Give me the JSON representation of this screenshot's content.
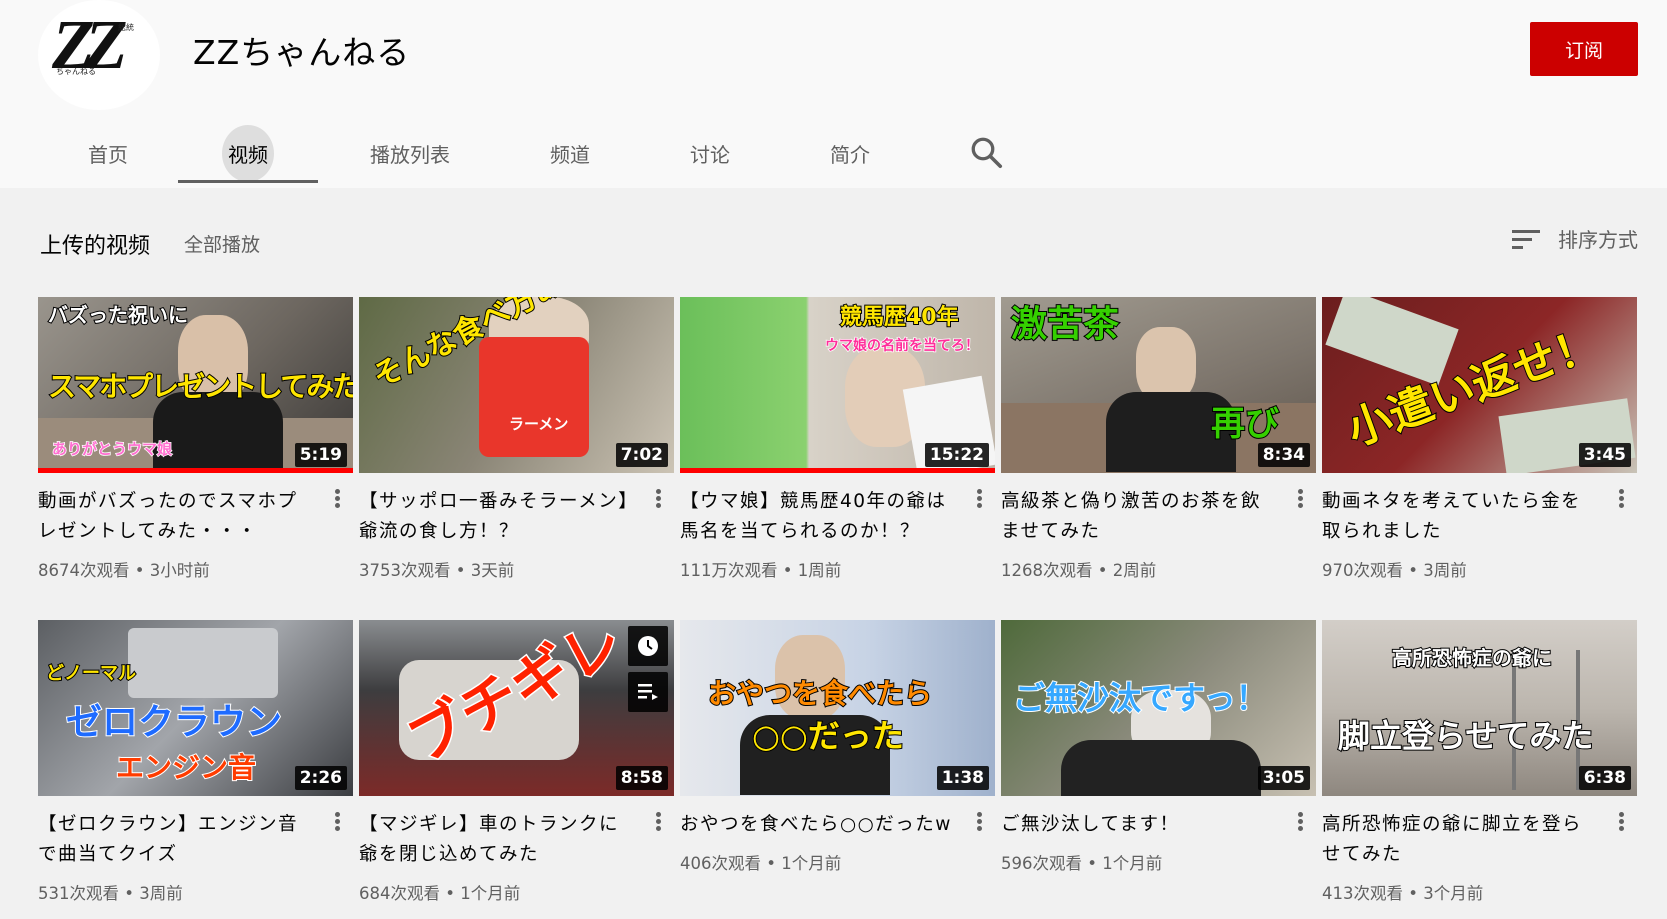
{
  "channel": {
    "name": "ZZちゃんねる",
    "avatar_text": "ZZ",
    "avatar_small_top": "総統",
    "avatar_small_bottom": "ちゃんねる",
    "subscribe_label": "订阅"
  },
  "tabs": [
    {
      "label": "首页",
      "active": false
    },
    {
      "label": "视频",
      "active": true
    },
    {
      "label": "播放列表",
      "active": false
    },
    {
      "label": "频道",
      "active": false
    },
    {
      "label": "讨论",
      "active": false
    },
    {
      "label": "简介",
      "active": false
    }
  ],
  "section": {
    "title": "上传的视频",
    "play_all": "全部播放",
    "sort_label": "排序方式"
  },
  "colors": {
    "subscribe": "#cc0000",
    "progress": "#ff0000",
    "text_secondary": "#606060"
  },
  "videos": [
    {
      "title": "動画がバズったのでスマホプレゼントしてみた・・・",
      "views": "8674次观看",
      "age": "3小时前",
      "duration": "5:19",
      "thumb_lines": [
        "バズった祝いに",
        "スマホプレゼントしてみた",
        "ありがとうウマ娘"
      ],
      "watched": 1.0
    },
    {
      "title": "【サッポロ一番みそラーメン】爺流の食し方！？",
      "views": "3753次观看",
      "age": "3天前",
      "duration": "7:02",
      "thumb_lines": [
        "そんな食べ方あり？",
        "ラーメン"
      ],
      "watched": 0
    },
    {
      "title": "【ウマ娘】競馬歴40年の爺は馬名を当てられるのか！？",
      "views": "111万次观看",
      "age": "1周前",
      "duration": "15:22",
      "thumb_lines": [
        "競馬歴40年",
        "ウマ娘の名前を当てろ！"
      ],
      "watched": 1.0
    },
    {
      "title": "高級茶と偽り激苦のお茶を飲ませてみた",
      "views": "1268次观看",
      "age": "2周前",
      "duration": "8:34",
      "thumb_lines": [
        "激苦茶",
        "再び"
      ],
      "watched": 0
    },
    {
      "title": "動画ネタを考えていたら金を取られました",
      "views": "970次观看",
      "age": "3周前",
      "duration": "3:45",
      "thumb_lines": [
        "小遣い返せ！"
      ],
      "watched": 0
    },
    {
      "title": "【ゼロクラウン】エンジン音で曲当てクイズ",
      "views": "531次观看",
      "age": "3周前",
      "duration": "2:26",
      "thumb_lines": [
        "どノーマル",
        "ゼロクラウン",
        "エンジン音"
      ],
      "watched": 0
    },
    {
      "title": "【マジギレ】車のトランクに爺を閉じ込めてみた",
      "views": "684次观看",
      "age": "1个月前",
      "duration": "8:58",
      "thumb_lines": [
        "ブチギレ"
      ],
      "watched": 0
    },
    {
      "title": "おやつを食べたら○○だったw",
      "views": "406次观看",
      "age": "1个月前",
      "duration": "1:38",
      "thumb_lines": [
        "おやつを食べたら",
        "○○だった"
      ],
      "watched": 0
    },
    {
      "title": "ご無沙汰してます！",
      "views": "596次观看",
      "age": "1个月前",
      "duration": "3:05",
      "thumb_lines": [
        "ご無沙汰ですっ！"
      ],
      "watched": 0
    },
    {
      "title": "高所恐怖症の爺に脚立を登らせてみた",
      "views": "413次观看",
      "age": "3个月前",
      "duration": "6:38",
      "thumb_lines": [
        "高所恐怖症の爺に",
        "脚立登らせてみた"
      ],
      "watched": 0
    }
  ]
}
